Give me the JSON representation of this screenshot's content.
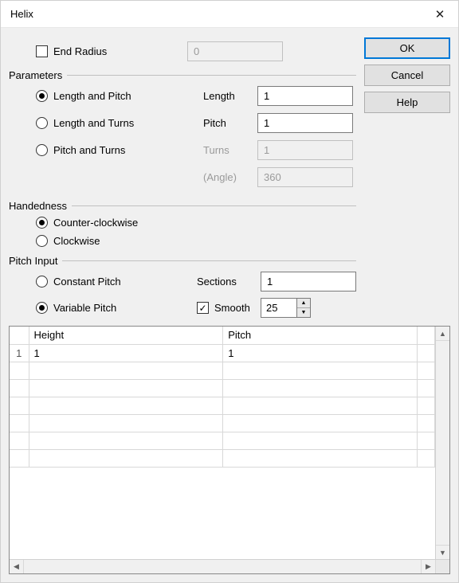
{
  "window": {
    "title": "Helix"
  },
  "header": {
    "end_radius_label": "End Radius",
    "end_radius_checked": false,
    "end_radius_value": "0"
  },
  "buttons": {
    "ok": "OK",
    "cancel": "Cancel",
    "help": "Help"
  },
  "groups": {
    "parameters": "Parameters",
    "handedness": "Handedness",
    "pitch_input": "Pitch Input"
  },
  "parameters": {
    "radios": {
      "length_pitch": "Length and Pitch",
      "length_turns": "Length and Turns",
      "pitch_turns": "Pitch and Turns",
      "selected": "length_pitch"
    },
    "fields": {
      "length": {
        "label": "Length",
        "value": "1",
        "enabled": true
      },
      "pitch": {
        "label": "Pitch",
        "value": "1",
        "enabled": true
      },
      "turns": {
        "label": "Turns",
        "value": "1",
        "enabled": false
      },
      "angle": {
        "label": "(Angle)",
        "value": "360",
        "enabled": false
      }
    }
  },
  "handedness": {
    "ccw": "Counter-clockwise",
    "cw": "Clockwise",
    "selected": "ccw"
  },
  "pitch_input": {
    "constant": "Constant Pitch",
    "variable": "Variable Pitch",
    "selected": "variable",
    "sections_label": "Sections",
    "sections_value": "1",
    "smooth_label": "Smooth",
    "smooth_checked": true,
    "smooth_value": "25"
  },
  "table": {
    "columns": {
      "height": "Height",
      "pitch": "Pitch"
    },
    "rows": [
      {
        "idx": "1",
        "height": "1",
        "pitch": "1"
      }
    ]
  }
}
